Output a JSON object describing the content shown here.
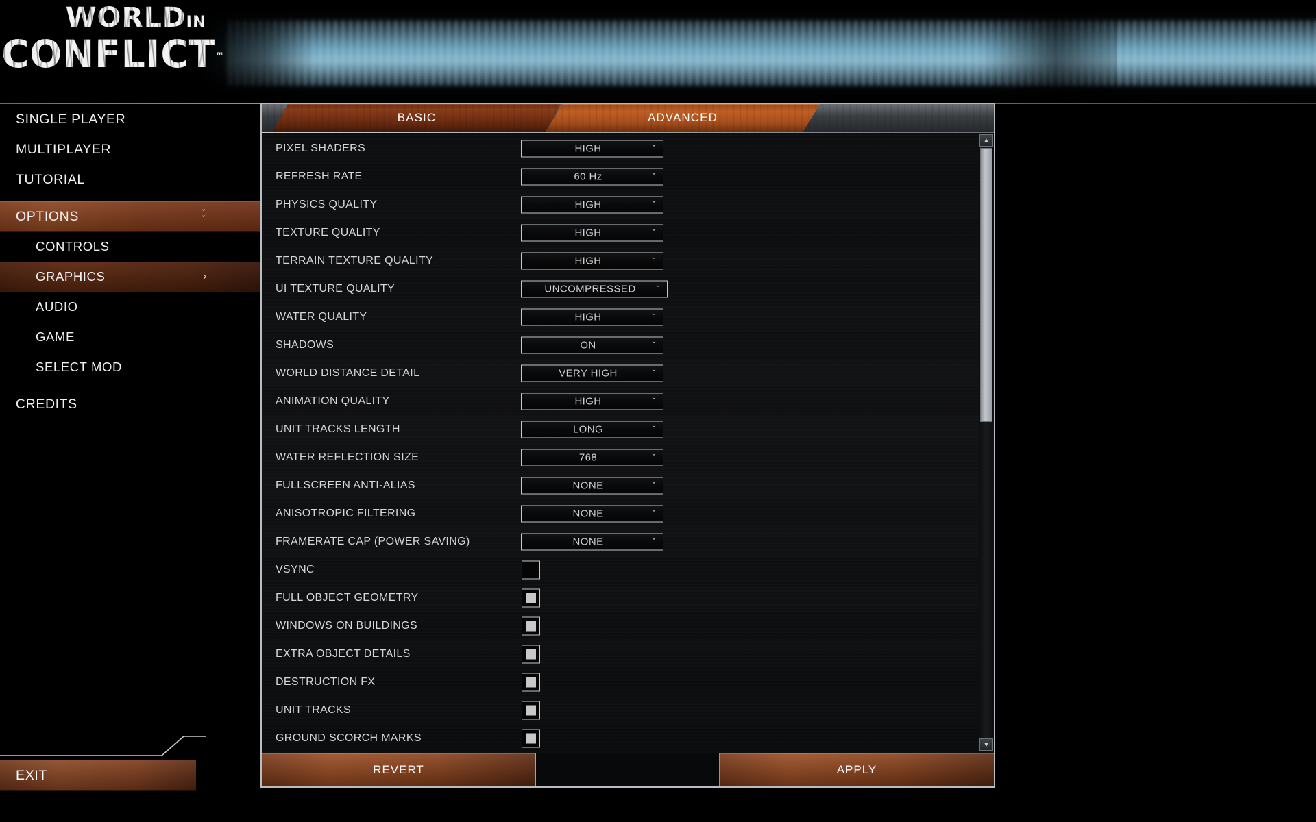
{
  "logo": {
    "line1": "WORLD",
    "line1_small": "IN",
    "line2": "CONFLICT",
    "tm": "™"
  },
  "sidebar": {
    "items": [
      {
        "label": "SINGLE PLAYER",
        "level": "main",
        "state": "normal",
        "chevron": ""
      },
      {
        "label": "MULTIPLAYER",
        "level": "main",
        "state": "normal",
        "chevron": ""
      },
      {
        "label": "TUTORIAL",
        "level": "main",
        "state": "normal",
        "chevron": ""
      },
      {
        "label": "OPTIONS",
        "level": "main",
        "state": "selected",
        "chevron": "ˇˇ"
      },
      {
        "label": "CONTROLS",
        "level": "sub",
        "state": "normal",
        "chevron": ""
      },
      {
        "label": "GRAPHICS",
        "level": "sub",
        "state": "active",
        "chevron": "›"
      },
      {
        "label": "AUDIO",
        "level": "sub",
        "state": "normal",
        "chevron": ""
      },
      {
        "label": "GAME",
        "level": "sub",
        "state": "normal",
        "chevron": ""
      },
      {
        "label": "SELECT MOD",
        "level": "sub",
        "state": "normal",
        "chevron": ""
      },
      {
        "label": "CREDITS",
        "level": "main",
        "state": "normal",
        "chevron": ""
      }
    ],
    "exit_label": "EXIT"
  },
  "tabs": [
    {
      "label": "BASIC",
      "active": false
    },
    {
      "label": "ADVANCED",
      "active": true
    }
  ],
  "settings": [
    {
      "label": "PIXEL SHADERS",
      "type": "dropdown",
      "value": "HIGH"
    },
    {
      "label": "REFRESH RATE",
      "type": "dropdown",
      "value": "60 Hz"
    },
    {
      "label": "PHYSICS QUALITY",
      "type": "dropdown",
      "value": "HIGH"
    },
    {
      "label": "TEXTURE QUALITY",
      "type": "dropdown",
      "value": "HIGH"
    },
    {
      "label": "TERRAIN TEXTURE QUALITY",
      "type": "dropdown",
      "value": "HIGH"
    },
    {
      "label": "UI TEXTURE QUALITY",
      "type": "dropdown",
      "value": "UNCOMPRESSED"
    },
    {
      "label": "WATER QUALITY",
      "type": "dropdown",
      "value": "HIGH"
    },
    {
      "label": "SHADOWS",
      "type": "dropdown",
      "value": "ON"
    },
    {
      "label": "WORLD DISTANCE DETAIL",
      "type": "dropdown",
      "value": "VERY HIGH"
    },
    {
      "label": "ANIMATION QUALITY",
      "type": "dropdown",
      "value": "HIGH"
    },
    {
      "label": "UNIT TRACKS LENGTH",
      "type": "dropdown",
      "value": "LONG"
    },
    {
      "label": "WATER REFLECTION SIZE",
      "type": "dropdown",
      "value": "768"
    },
    {
      "label": "FULLSCREEN ANTI-ALIAS",
      "type": "dropdown",
      "value": "NONE"
    },
    {
      "label": "ANISOTROPIC FILTERING",
      "type": "dropdown",
      "value": "NONE"
    },
    {
      "label": "FRAMERATE CAP (POWER SAVING)",
      "type": "dropdown",
      "value": "NONE"
    },
    {
      "label": "VSYNC",
      "type": "checkbox",
      "checked": false
    },
    {
      "label": "FULL OBJECT GEOMETRY",
      "type": "checkbox",
      "checked": true
    },
    {
      "label": "WINDOWS ON BUILDINGS",
      "type": "checkbox",
      "checked": true
    },
    {
      "label": "EXTRA OBJECT DETAILS",
      "type": "checkbox",
      "checked": true
    },
    {
      "label": "DESTRUCTION FX",
      "type": "checkbox",
      "checked": true
    },
    {
      "label": "UNIT TRACKS",
      "type": "checkbox",
      "checked": true
    },
    {
      "label": "GROUND SCORCH MARKS",
      "type": "checkbox",
      "checked": true
    }
  ],
  "dropdown_arrow": "ˇ",
  "scrollbar": {
    "up_arrow": "▲",
    "down_arrow": "▼"
  },
  "footer": {
    "revert_label": "REVERT",
    "apply_label": "APPLY"
  },
  "colors": {
    "accent_orange": "#9c4b21",
    "accent_orange_bright": "#c15f24",
    "accent_orange_dark": "#4f210d",
    "panel_border": "#b9bdc2",
    "text": "#d6d6d6",
    "banner_cyan": "#96cde6"
  }
}
